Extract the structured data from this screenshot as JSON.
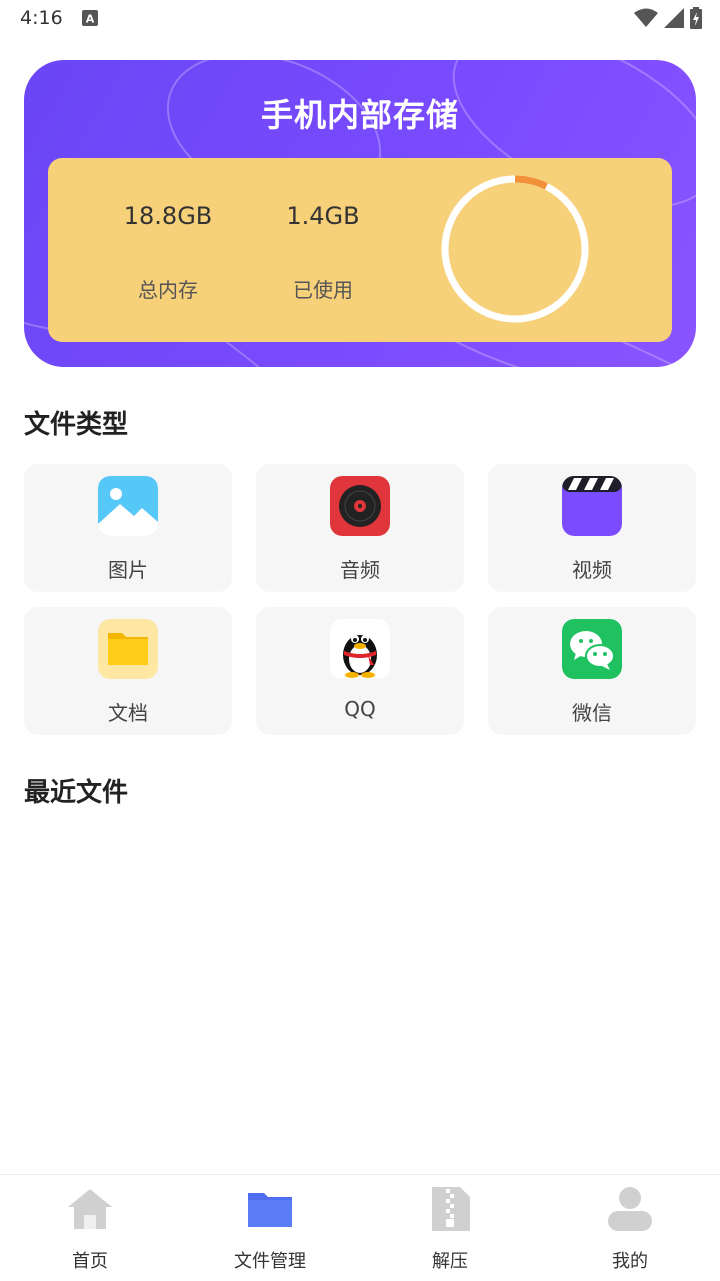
{
  "status_bar": {
    "time": "4:16"
  },
  "storage": {
    "title": "手机内部存储",
    "total_value": "18.8GB",
    "total_label": "总内存",
    "used_value": "1.4GB",
    "used_label": "已使用",
    "used_fraction": 0.074,
    "ring_track_color": "#ffffff",
    "ring_used_color": "#f2913a"
  },
  "file_types": {
    "title": "文件类型",
    "items": [
      {
        "label": "图片",
        "icon": "image-icon"
      },
      {
        "label": "音频",
        "icon": "audio-icon"
      },
      {
        "label": "视频",
        "icon": "video-icon"
      },
      {
        "label": "文档",
        "icon": "folder-icon"
      },
      {
        "label": "QQ",
        "icon": "qq-icon"
      },
      {
        "label": "微信",
        "icon": "wechat-icon"
      }
    ]
  },
  "recent": {
    "title": "最近文件"
  },
  "nav": {
    "items": [
      {
        "label": "首页",
        "icon": "home-icon",
        "active": false
      },
      {
        "label": "文件管理",
        "icon": "folder-icon",
        "active": true
      },
      {
        "label": "解压",
        "icon": "zip-icon",
        "active": false
      },
      {
        "label": "我的",
        "icon": "user-icon",
        "active": false
      }
    ],
    "active_color": "#5b7cf7",
    "inactive_color": "#d0d0d0"
  }
}
